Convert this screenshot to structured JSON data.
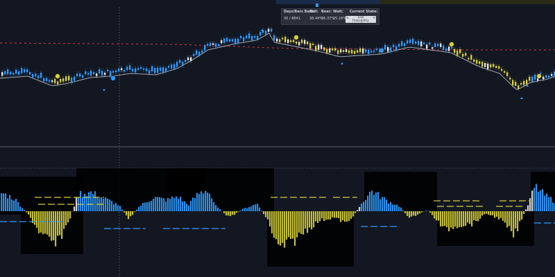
{
  "chart_data": [
    {
      "type": "candlestick",
      "panel": "price",
      "x": "bar index",
      "bar_count": 200,
      "trend_line_colors": {
        "bull": "#2f9bff",
        "bear": "#d6d03a"
      },
      "resistance_line": "dashed",
      "resistance_color": "#e0383e",
      "signal_markers": [
        "circle-yellow",
        "circle-blue",
        "arrow"
      ]
    },
    {
      "type": "bar",
      "panel": "oscillator",
      "x": "bar index",
      "zero_line": true,
      "colors": {
        "bull": "#2f9bff",
        "bear": "#d6d03a",
        "neutral": "#e8e8e8",
        "zone_bull": "#1f4873",
        "zone_bear": "#4a4a22"
      }
    }
  ],
  "info_panel": {
    "headers": [
      "Days/Bars Back:",
      "Bull:",
      "Bear:",
      "Wait:",
      "Current State:"
    ],
    "values": [
      "30 / 8841",
      "38.44%",
      "36.37%",
      "25.16%"
    ],
    "state_label": "Low Probability Wait Zone"
  },
  "colors": {
    "background": "#131722",
    "bull": "#2f9bff",
    "bear": "#d6d03a",
    "neutral": "#e8e8e8",
    "resistance": "#e0383e",
    "separator": "#5d6068"
  }
}
